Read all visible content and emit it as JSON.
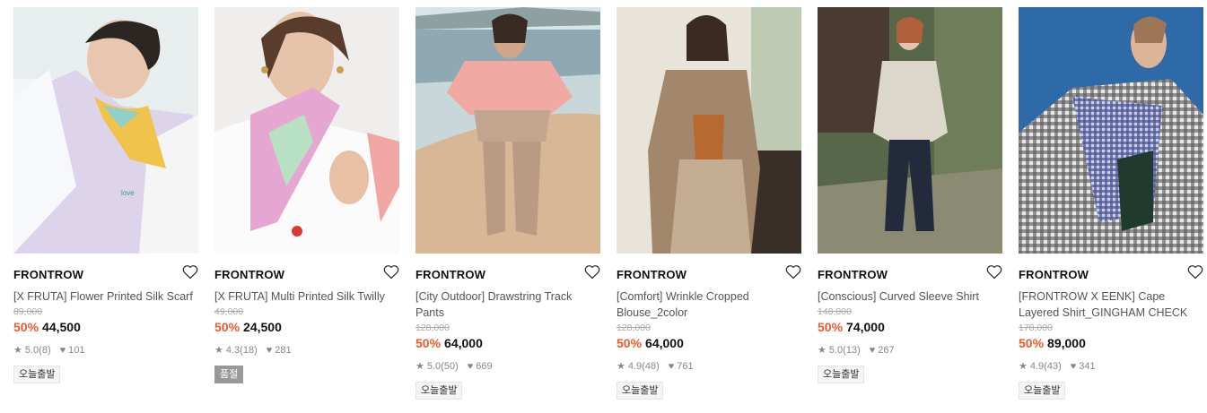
{
  "products": [
    {
      "brand": "FRONTROW",
      "title": "[X FRUTA] Flower Printed Silk Scarf",
      "original_price": "89,000",
      "discount": "50%",
      "price": "44,500",
      "rating": "5.0",
      "reviews": "(8)",
      "likes": "101",
      "badge": "오늘출발",
      "badge_type": "today"
    },
    {
      "brand": "FRONTROW",
      "title": "[X FRUTA] Multi Printed Silk Twilly",
      "original_price": "49,000",
      "discount": "50%",
      "price": "24,500",
      "rating": "4.3",
      "reviews": "(18)",
      "likes": "281",
      "badge": "품절",
      "badge_type": "soldout"
    },
    {
      "brand": "FRONTROW",
      "title": "[City Outdoor] Drawstring Track Pants",
      "original_price": "128,000",
      "discount": "50%",
      "price": "64,000",
      "rating": "5.0",
      "reviews": "(50)",
      "likes": "669",
      "badge": "오늘출발",
      "badge_type": "today"
    },
    {
      "brand": "FRONTROW",
      "title": "[Comfort] Wrinkle Cropped Blouse_2color",
      "original_price": "128,000",
      "discount": "50%",
      "price": "64,000",
      "rating": "4.9",
      "reviews": "(48)",
      "likes": "761",
      "badge": "오늘출발",
      "badge_type": "today"
    },
    {
      "brand": "FRONTROW",
      "title": "[Conscious] Curved Sleeve Shirt",
      "original_price": "148,000",
      "discount": "50%",
      "price": "74,000",
      "rating": "5.0",
      "reviews": "(13)",
      "likes": "267",
      "badge": "오늘출발",
      "badge_type": "today"
    },
    {
      "brand": "FRONTROW",
      "title": "[FRONTROW X EENK] Cape Layered Shirt_GINGHAM CHECK",
      "original_price": "178,000",
      "discount": "50%",
      "price": "89,000",
      "rating": "4.9",
      "reviews": "(43)",
      "likes": "341",
      "badge": "오늘출발",
      "badge_type": "today"
    }
  ],
  "colors": {
    "discount": "#ec5a2a",
    "badge_soldout_bg": "#999999",
    "badge_bg": "#f5f5f5"
  },
  "icons": {
    "wishlist": "heart-outline-icon",
    "rating": "star-icon",
    "likes": "heart-filled-icon"
  }
}
